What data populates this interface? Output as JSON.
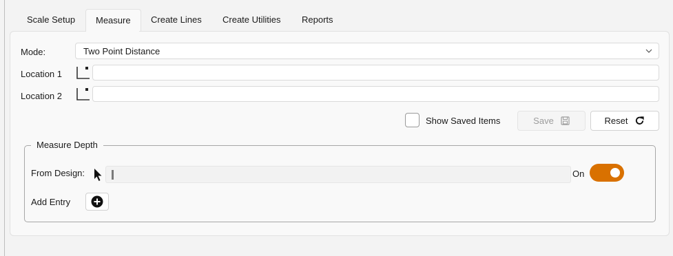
{
  "tabs": [
    "Scale Setup",
    "Measure",
    "Create Lines",
    "Create Utilities",
    "Reports"
  ],
  "active_tab": "Measure",
  "mode": {
    "label": "Mode:",
    "value": "Two Point Distance"
  },
  "location1": {
    "label": "Location 1",
    "value": ""
  },
  "location2": {
    "label": "Location 2",
    "value": ""
  },
  "show_saved": {
    "label": "Show Saved Items",
    "checked": false
  },
  "buttons": {
    "save": "Save",
    "reset": "Reset"
  },
  "measure_depth": {
    "title": "Measure Depth",
    "from_design_label": "From Design:",
    "from_design_value": "",
    "toggle_label": "On",
    "toggle_on": true,
    "add_entry_label": "Add Entry"
  },
  "colors": {
    "accent": "#d97100"
  }
}
